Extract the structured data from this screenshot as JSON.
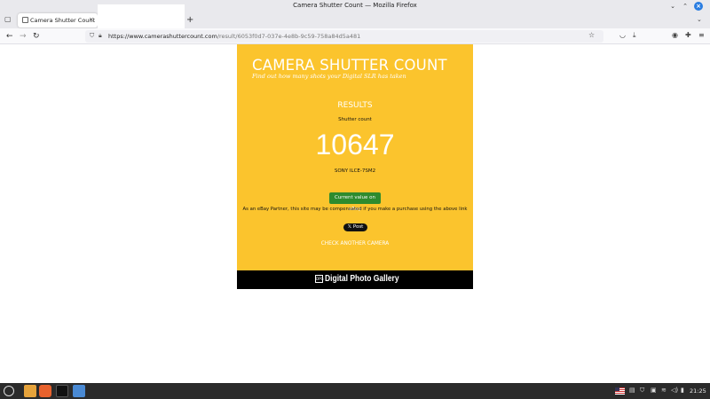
{
  "window": {
    "title": "Camera Shutter Count — Mozilla Firefox",
    "minimize_glyph": "⌄",
    "maximize_glyph": "⌃",
    "close_glyph": "×"
  },
  "tabs": [
    {
      "label": "Camera Shutter Count",
      "close_glyph": "×"
    }
  ],
  "tabstrip": {
    "new_tab_glyph": "+",
    "tab_list_glyph": "⌄",
    "overview_glyph": "▢"
  },
  "navbar": {
    "back_glyph": "←",
    "forward_glyph": "→",
    "reload_glyph": "↻",
    "url_prefix": "https://www.camerashuttercount.com",
    "url_rest": "/result/6053f0d7-037e-4e8b-9c59-758a84d5a481",
    "bookmark_glyph": "☆"
  },
  "page": {
    "site_title": "CAMERA SHUTTER COUNT",
    "tagline": "Find out how many shots your Digital SLR has taken",
    "results_heading": "RESULTS",
    "count_label": "Shutter count",
    "count_value": "10647",
    "camera_model": "SONY ILCE-7SM2",
    "ebay_button": "Current value on eBay",
    "disclaimer": "As an eBay Partner, this site may be compensated if you make a purchase using the above link",
    "xpost_button": "𝕏 Post",
    "check_another": "CHECK ANOTHER CAMERA",
    "footer_logo_badge": "DPG",
    "footer_logo": "Digital Photo Gallery"
  },
  "taskbar": {
    "clock": "21:25"
  },
  "colors": {
    "card_bg": "#fbc42d",
    "ebay_button": "#2e8b2e",
    "footer_bg": "#000000"
  }
}
